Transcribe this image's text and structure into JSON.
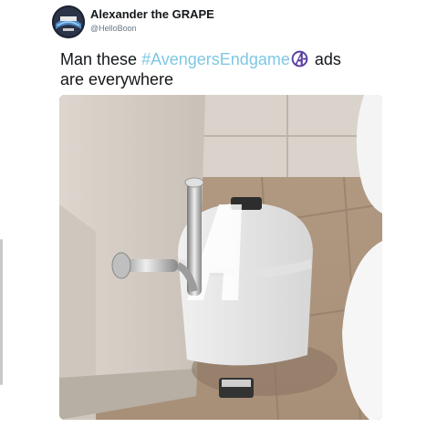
{
  "tweet": {
    "display_name": "Alexander the GRAPE",
    "handle": "@HelloBoon",
    "text_before": "Man these ",
    "hashtag": "#AvengersEndgame",
    "text_after": " ads",
    "text_line2": "are everywhere"
  },
  "media": {
    "description_icon": "photo-icon"
  },
  "colors": {
    "hashtag": "#7ec8e3",
    "emoji_purple": "#5b3fa0",
    "text": "#14171a",
    "handle": "#657786"
  }
}
